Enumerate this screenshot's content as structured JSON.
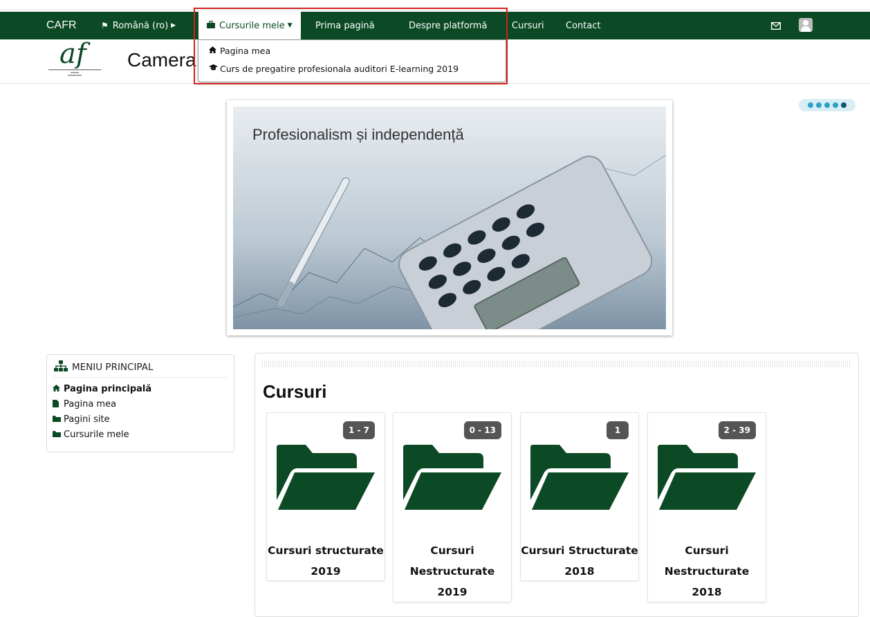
{
  "navbar": {
    "brand": "CAFR",
    "language": "Română (ro)",
    "my_courses": "Cursurile mele",
    "home": "Prima pagină",
    "about": "Despre platformă",
    "courses": "Cursuri",
    "contact": "Contact"
  },
  "dropdown": {
    "items": [
      {
        "label": "Pagina mea",
        "icon": "home-icon"
      },
      {
        "label": "Curs de pregatire profesionala auditori E-learning 2019",
        "icon": "graduation-cap-icon"
      }
    ]
  },
  "header": {
    "title": "Camera Auditorilor Financiari din Romania",
    "logo_letters": "af"
  },
  "banner": {
    "caption": "Profesionalism și independență"
  },
  "sidebar": {
    "title": "MENIU PRINCIPAL",
    "items": [
      {
        "label": "Pagina principală",
        "icon": "home-icon",
        "bold": true
      },
      {
        "label": "Pagina mea",
        "icon": "file-icon"
      },
      {
        "label": "Pagini site",
        "icon": "folder-icon"
      },
      {
        "label": "Cursurile mele",
        "icon": "folder-icon"
      }
    ]
  },
  "main": {
    "title": "Cursuri",
    "categories": [
      {
        "name": "Cursuri structurate 2019",
        "badge": "1 - 7"
      },
      {
        "name": "Cursuri Nestructurate 2019",
        "badge": "0 - 13"
      },
      {
        "name": "Cursuri Structurate 2018",
        "badge": "1"
      },
      {
        "name": "Cursuri Nestructurate 2018",
        "badge": "2 - 39"
      }
    ]
  },
  "colors": {
    "primary": "#0b4a24",
    "highlight": "#d22020",
    "badge": "#555555",
    "slider_dot": "#2fa0c8"
  }
}
